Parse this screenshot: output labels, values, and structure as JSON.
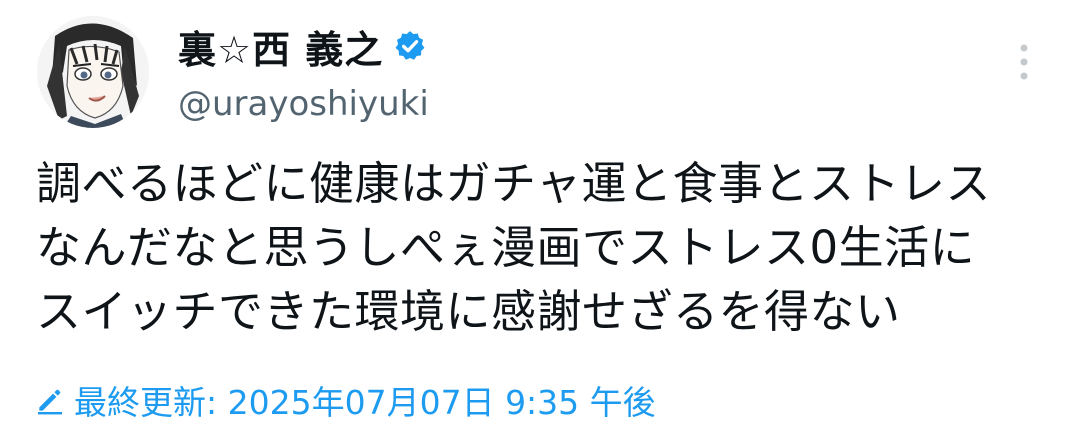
{
  "user": {
    "display_name": "裏☆西 義之",
    "username": "@urayoshiyuki",
    "verified": true,
    "avatar_icon": "avatar-illustration-icon"
  },
  "tweet": {
    "lines": [
      "調べるほどに健康はガチャ運と食事とストレス",
      "なんだなと思うしぺぇ漫画でストレス0生活に",
      "スイッチできた環境に感謝せざるを得ない"
    ]
  },
  "edited": {
    "label": "最終更新: 2025年07月07日 9:35 午後",
    "icon": "pencil-icon"
  },
  "colors": {
    "accent": "#1d9bf0",
    "secondary_text": "#536471",
    "primary_text": "#0f1419",
    "more_dots": "#c4c9cd"
  }
}
